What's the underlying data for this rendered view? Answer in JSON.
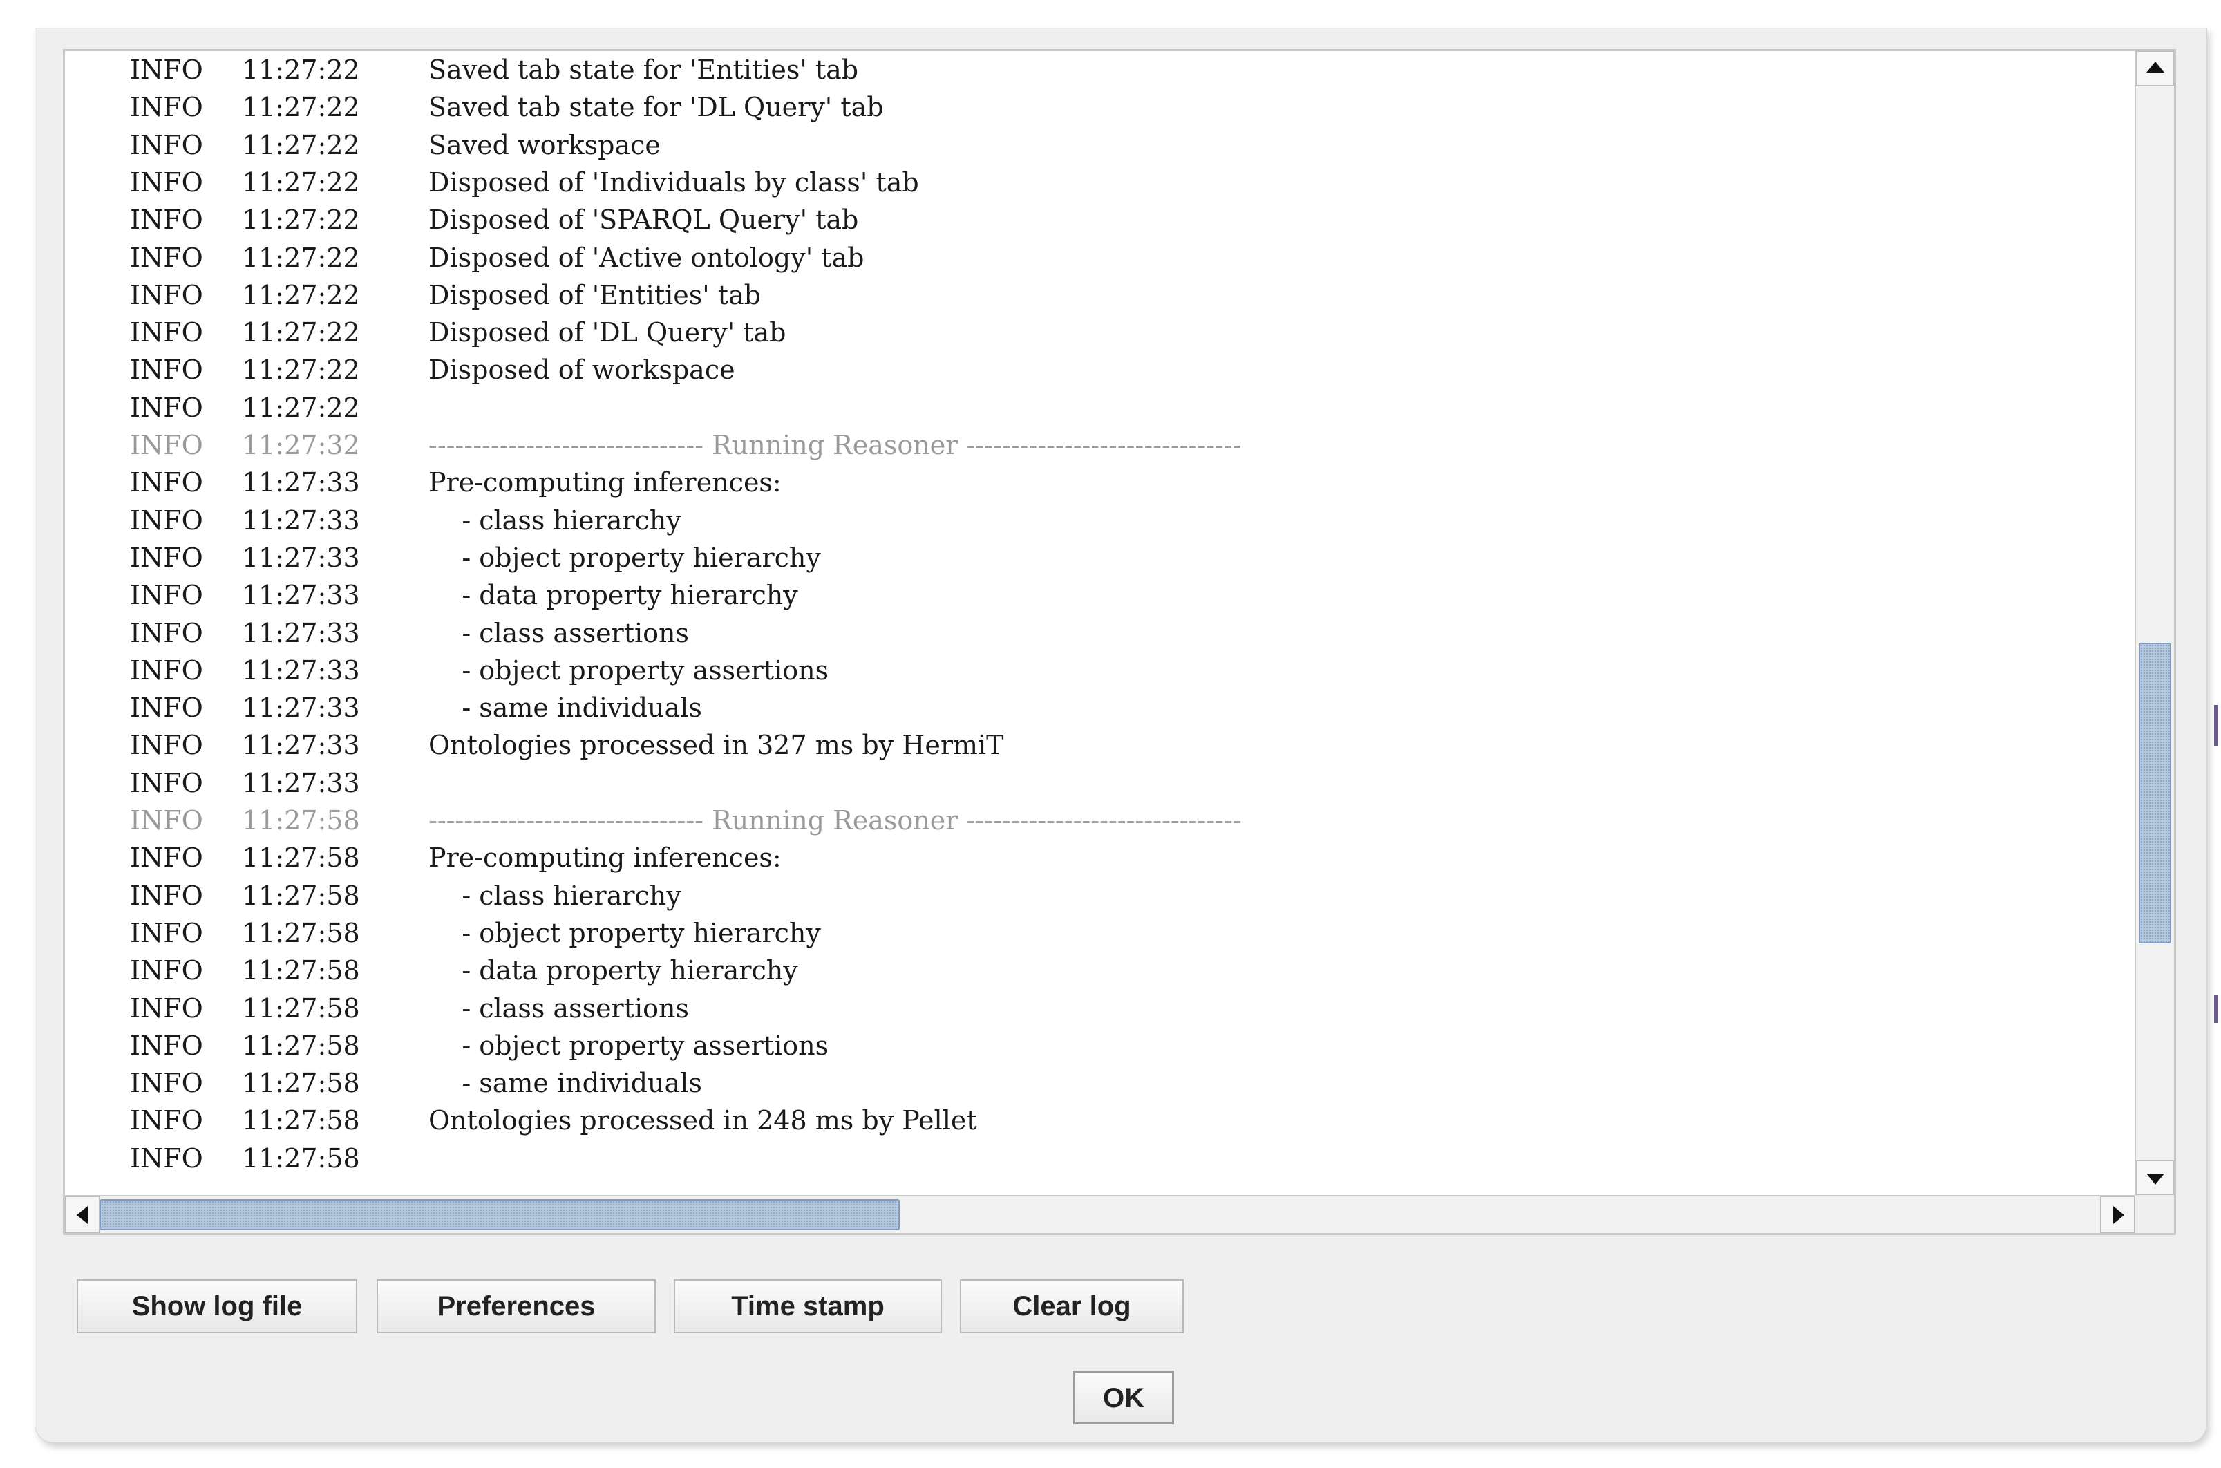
{
  "log": {
    "lines": [
      {
        "level": "INFO",
        "time": "11:27:22",
        "message": "Saved tab state for 'Entities' tab",
        "dim": false
      },
      {
        "level": "INFO",
        "time": "11:27:22",
        "message": "Saved tab state for 'DL Query' tab",
        "dim": false
      },
      {
        "level": "INFO",
        "time": "11:27:22",
        "message": "Saved workspace",
        "dim": false
      },
      {
        "level": "INFO",
        "time": "11:27:22",
        "message": "Disposed of 'Individuals by class' tab",
        "dim": false
      },
      {
        "level": "INFO",
        "time": "11:27:22",
        "message": "Disposed of 'SPARQL Query' tab",
        "dim": false
      },
      {
        "level": "INFO",
        "time": "11:27:22",
        "message": "Disposed of 'Active ontology' tab",
        "dim": false
      },
      {
        "level": "INFO",
        "time": "11:27:22",
        "message": "Disposed of 'Entities' tab",
        "dim": false
      },
      {
        "level": "INFO",
        "time": "11:27:22",
        "message": "Disposed of 'DL Query' tab",
        "dim": false
      },
      {
        "level": "INFO",
        "time": "11:27:22",
        "message": "Disposed of workspace",
        "dim": false
      },
      {
        "level": "INFO",
        "time": "11:27:22",
        "message": "",
        "dim": false
      },
      {
        "level": "INFO",
        "time": "11:27:32",
        "message": "------------------------------- Running Reasoner -------------------------------",
        "dim": true
      },
      {
        "level": "INFO",
        "time": "11:27:33",
        "message": "Pre-computing inferences:",
        "dim": false
      },
      {
        "level": "INFO",
        "time": "11:27:33",
        "message": "    - class hierarchy",
        "dim": false
      },
      {
        "level": "INFO",
        "time": "11:27:33",
        "message": "    - object property hierarchy",
        "dim": false
      },
      {
        "level": "INFO",
        "time": "11:27:33",
        "message": "    - data property hierarchy",
        "dim": false
      },
      {
        "level": "INFO",
        "time": "11:27:33",
        "message": "    - class assertions",
        "dim": false
      },
      {
        "level": "INFO",
        "time": "11:27:33",
        "message": "    - object property assertions",
        "dim": false
      },
      {
        "level": "INFO",
        "time": "11:27:33",
        "message": "    - same individuals",
        "dim": false
      },
      {
        "level": "INFO",
        "time": "11:27:33",
        "message": "Ontologies processed in 327 ms by HermiT",
        "dim": false
      },
      {
        "level": "INFO",
        "time": "11:27:33",
        "message": "",
        "dim": false
      },
      {
        "level": "INFO",
        "time": "11:27:58",
        "message": "------------------------------- Running Reasoner -------------------------------",
        "dim": true
      },
      {
        "level": "INFO",
        "time": "11:27:58",
        "message": "Pre-computing inferences:",
        "dim": false
      },
      {
        "level": "INFO",
        "time": "11:27:58",
        "message": "    - class hierarchy",
        "dim": false
      },
      {
        "level": "INFO",
        "time": "11:27:58",
        "message": "    - object property hierarchy",
        "dim": false
      },
      {
        "level": "INFO",
        "time": "11:27:58",
        "message": "    - data property hierarchy",
        "dim": false
      },
      {
        "level": "INFO",
        "time": "11:27:58",
        "message": "    - class assertions",
        "dim": false
      },
      {
        "level": "INFO",
        "time": "11:27:58",
        "message": "    - object property assertions",
        "dim": false
      },
      {
        "level": "INFO",
        "time": "11:27:58",
        "message": "    - same individuals",
        "dim": false
      },
      {
        "level": "INFO",
        "time": "11:27:58",
        "message": "Ontologies processed in 248 ms by Pellet",
        "dim": false
      },
      {
        "level": "INFO",
        "time": "11:27:58",
        "message": "",
        "dim": false
      }
    ]
  },
  "scrollbars": {
    "vertical": {
      "position": 0.72,
      "visible_fraction": 0.28
    },
    "horizontal": {
      "position": 0.0,
      "visible_fraction": 0.4
    }
  },
  "buttons": {
    "show_log_file": "Show log file",
    "preferences": "Preferences",
    "time_stamp": "Time stamp",
    "clear_log": "Clear log",
    "ok": "OK"
  },
  "icons": {
    "scroll_up": "arrow-up-icon",
    "scroll_down": "arrow-down-icon",
    "scroll_left": "arrow-left-icon",
    "scroll_right": "arrow-right-icon"
  },
  "colors": {
    "dim_text": "#9a9a9a",
    "scroll_thumb": "#b8c9de"
  }
}
